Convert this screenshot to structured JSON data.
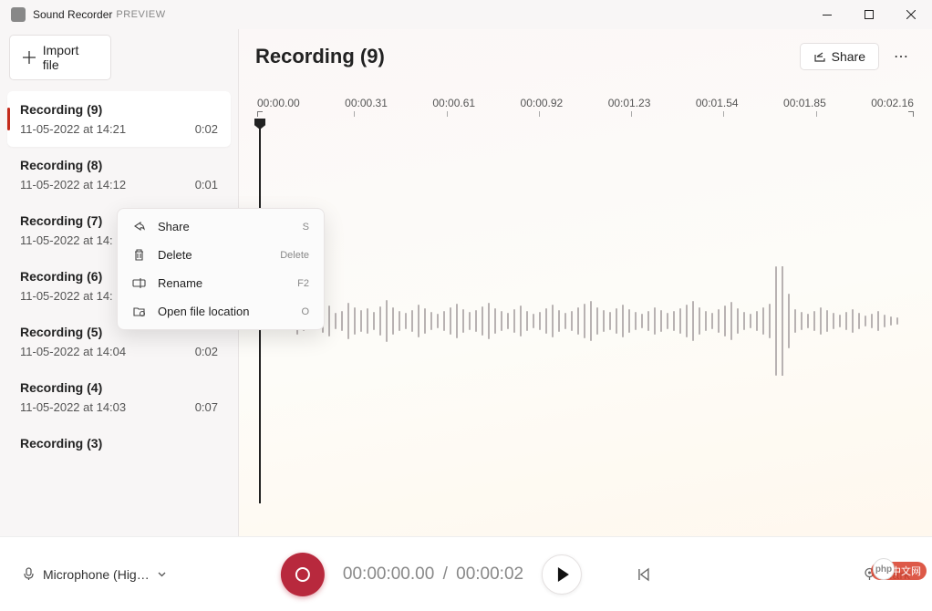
{
  "titlebar": {
    "app_name": "Sound Recorder",
    "preview": "PREVIEW"
  },
  "sidebar": {
    "import_label": "Import file",
    "items": [
      {
        "title": "Recording (9)",
        "date": "11-05-2022 at 14:21",
        "dur": "0:02"
      },
      {
        "title": "Recording (8)",
        "date": "11-05-2022 at 14:12",
        "dur": "0:01"
      },
      {
        "title": "Recording (7)",
        "date": "11-05-2022 at 14:",
        "dur": ""
      },
      {
        "title": "Recording (6)",
        "date": "11-05-2022 at 14:",
        "dur": ""
      },
      {
        "title": "Recording (5)",
        "date": "11-05-2022 at 14:04",
        "dur": "0:02"
      },
      {
        "title": "Recording (4)",
        "date": "11-05-2022 at 14:03",
        "dur": "0:07"
      },
      {
        "title": "Recording (3)",
        "date": "",
        "dur": ""
      }
    ]
  },
  "content": {
    "title": "Recording (9)",
    "share_label": "Share",
    "timeline": [
      "00:00.00",
      "00:00.31",
      "00:00.61",
      "00:00.92",
      "00:01.23",
      "00:01.54",
      "00:01.85",
      "00:02.16"
    ]
  },
  "context_menu": {
    "items": [
      {
        "label": "Share",
        "shortcut": "S",
        "icon": "share"
      },
      {
        "label": "Delete",
        "shortcut": "Delete",
        "icon": "delete"
      },
      {
        "label": "Rename",
        "shortcut": "F2",
        "icon": "rename"
      },
      {
        "label": "Open file location",
        "shortcut": "O",
        "icon": "open-location"
      }
    ]
  },
  "bottom": {
    "mic_label": "Microphone (Hig…",
    "time_current": "00:00:00.00",
    "time_total": "00:00:02",
    "mark_label": "Mark"
  },
  "watermark": "中文网"
}
